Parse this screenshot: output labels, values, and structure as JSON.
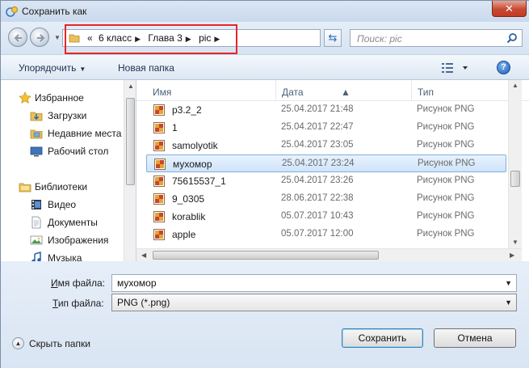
{
  "window": {
    "title": "Сохранить как",
    "close_label": "✕"
  },
  "address": {
    "crumbs": [
      "«",
      "6 класс",
      "Глава 3",
      "pic"
    ],
    "highlight_color": "#e5262a"
  },
  "search": {
    "placeholder": "Поиск: pic"
  },
  "toolbar": {
    "organize_label": "Упорядочить",
    "new_folder_label": "Новая папка",
    "help_label": "?"
  },
  "navpane": {
    "items": [
      {
        "label": "Избранное",
        "icon": "star-icon"
      },
      {
        "label": "Загрузки",
        "icon": "downloads-folder-icon"
      },
      {
        "label": "Недавние места",
        "icon": "recent-places-icon"
      },
      {
        "label": "Рабочий стол",
        "icon": "desktop-icon"
      },
      {
        "label": "Библиотеки",
        "icon": "libraries-icon"
      },
      {
        "label": "Видео",
        "icon": "video-library-icon"
      },
      {
        "label": "Документы",
        "icon": "documents-library-icon"
      },
      {
        "label": "Изображения",
        "icon": "pictures-library-icon"
      },
      {
        "label": "Музыка",
        "icon": "music-library-icon"
      }
    ]
  },
  "filelist": {
    "columns": {
      "name": "Имя",
      "date": "Дата",
      "type": "Тип"
    },
    "rows": [
      {
        "name": "p3.2_2",
        "date": "25.04.2017 21:48",
        "type": "Рисунок PNG"
      },
      {
        "name": "1",
        "date": "25.04.2017 22:47",
        "type": "Рисунок PNG"
      },
      {
        "name": "samolyotik",
        "date": "25.04.2017 23:05",
        "type": "Рисунок PNG"
      },
      {
        "name": "мухомор",
        "date": "25.04.2017 23:24",
        "type": "Рисунок PNG",
        "selected": true
      },
      {
        "name": "75615537_1",
        "date": "25.04.2017 23:26",
        "type": "Рисунок PNG"
      },
      {
        "name": "9_0305",
        "date": "28.06.2017 22:38",
        "type": "Рисунок PNG"
      },
      {
        "name": "korablik",
        "date": "05.07.2017 10:43",
        "type": "Рисунок PNG"
      },
      {
        "name": "apple",
        "date": "05.07.2017 12:00",
        "type": "Рисунок PNG"
      }
    ]
  },
  "form": {
    "filename_label_underlined": "И",
    "filename_label_rest": "мя файла:",
    "filename_value": "мухомор",
    "filetype_label_underlined": "Т",
    "filetype_label_rest": "ип файла:",
    "filetype_value": "PNG (*.png)",
    "hide_folders_label": "Скрыть папки",
    "save_label": "Сохранить",
    "cancel_label": "Отмена"
  }
}
